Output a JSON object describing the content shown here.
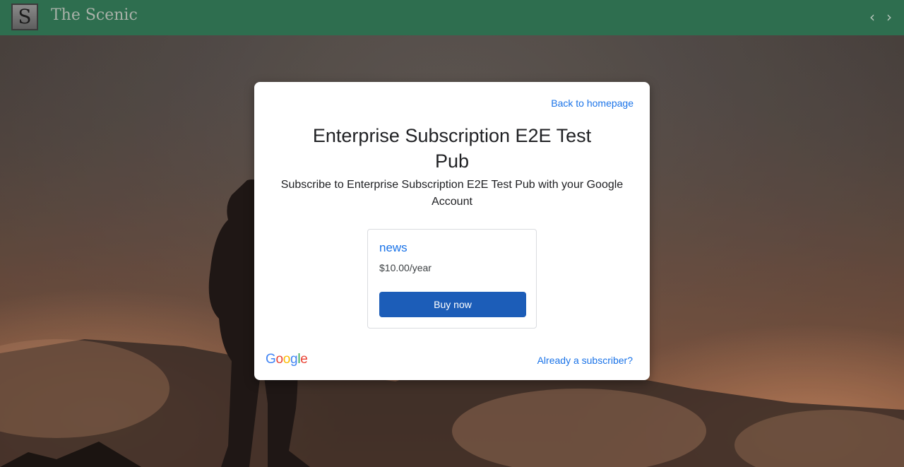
{
  "header": {
    "logo_letter": "S",
    "site_title": "The Scenic",
    "prev_arrow": "‹",
    "next_arrow": "›"
  },
  "dialog": {
    "back_link": "Back to homepage",
    "title": "Enterprise Subscription E2E Test Pub",
    "subtitle": "Subscribe to Enterprise Subscription E2E Test Pub with your Google Account",
    "offer": {
      "name": "news",
      "price": "$10.00/year",
      "button_label": "Buy now"
    },
    "google_logo": [
      "G",
      "o",
      "o",
      "g",
      "l",
      "e"
    ],
    "google_colors": [
      "#4285F4",
      "#EA4335",
      "#FBBC05",
      "#4285F4",
      "#34A853",
      "#EA4335"
    ],
    "already_subscriber": "Already a subscriber?"
  },
  "colors": {
    "header_bg": "#2e6e4f",
    "link": "#1a73e8",
    "button_bg": "#1c5db8"
  }
}
